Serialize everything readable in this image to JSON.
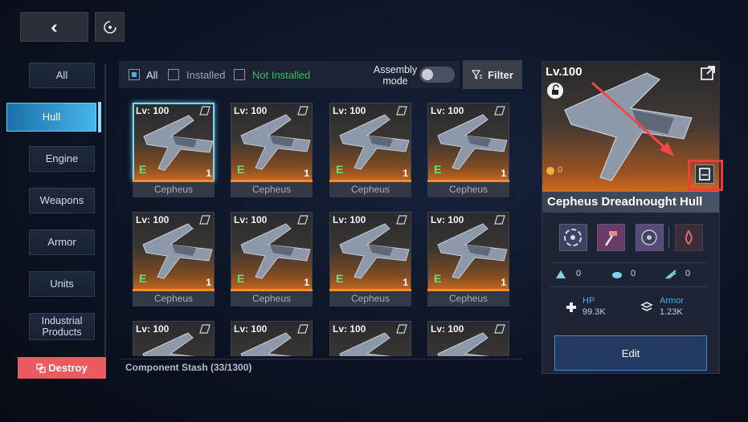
{
  "top_bar": {
    "back_icon": "double-chevron-left-icon",
    "settings_icon": "radar-icon"
  },
  "sidebar": {
    "items": [
      {
        "label": "All"
      },
      {
        "label": "Hull"
      },
      {
        "label": "Engine"
      },
      {
        "label": "Weapons"
      },
      {
        "label": "Armor"
      },
      {
        "label": "Units"
      },
      {
        "label": "Industrial Products"
      }
    ],
    "active": "Hull",
    "destroy_label": "Destroy"
  },
  "filters": {
    "all_label": "All",
    "installed_label": "Installed",
    "not_installed_label": "Not Installed",
    "assembly_label": "Assembly mode",
    "filter_label": "Filter"
  },
  "grid": {
    "cards": [
      {
        "level": "Lv: 100",
        "grade": "E",
        "count": "1",
        "name": "Cepheus"
      },
      {
        "level": "Lv: 100",
        "grade": "E",
        "count": "1",
        "name": "Cepheus"
      },
      {
        "level": "Lv: 100",
        "grade": "E",
        "count": "1",
        "name": "Cepheus"
      },
      {
        "level": "Lv: 100",
        "grade": "E",
        "count": "1",
        "name": "Cepheus"
      },
      {
        "level": "Lv: 100",
        "grade": "E",
        "count": "1",
        "name": "Cepheus"
      },
      {
        "level": "Lv: 100",
        "grade": "E",
        "count": "1",
        "name": "Cepheus"
      },
      {
        "level": "Lv: 100",
        "grade": "E",
        "count": "1",
        "name": "Cepheus"
      },
      {
        "level": "Lv: 100",
        "grade": "E",
        "count": "1",
        "name": "Cepheus"
      },
      {
        "level": "Lv: 100"
      },
      {
        "level": "Lv: 100"
      },
      {
        "level": "Lv: 100"
      },
      {
        "level": "Lv: 100"
      }
    ]
  },
  "stash_label": "Component Stash (33/1300)",
  "detail": {
    "level": "Lv.100",
    "power": "0",
    "title": "Cepheus Dreadnought Hull",
    "small_stats": [
      "0",
      "0",
      "0"
    ],
    "hp_label": "HP",
    "hp_value": "99.3K",
    "armor_label": "Armor",
    "armor_value": "1.23K",
    "edit_label": "Edit"
  },
  "colors": {
    "accent": "#45b6ea",
    "destroy": "#ea5a5e",
    "grade_e": "#5fe38a",
    "not_installed": "#2fc25b",
    "highlight": "#ef3b3b"
  }
}
